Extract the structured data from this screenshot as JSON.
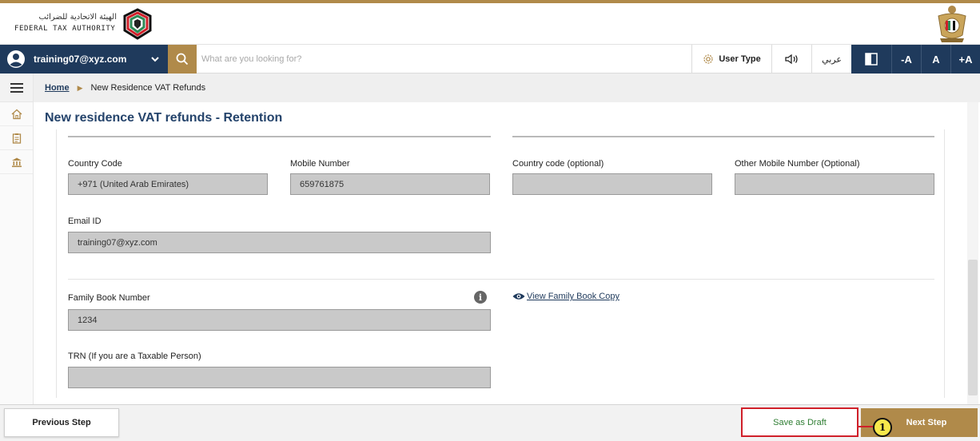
{
  "header": {
    "logo_arabic": "الهيئة الاتحادية للضرائب",
    "logo_english": "FEDERAL TAX AUTHORITY"
  },
  "toolbar": {
    "user_email": "training07@xyz.com",
    "search_placeholder": "What are you looking for?",
    "user_type_label": "User Type",
    "arabic_label": "عربي",
    "font_decrease": "-A",
    "font_normal": "A",
    "font_increase": "+A"
  },
  "breadcrumb": {
    "home": "Home",
    "current": "New Residence VAT Refunds"
  },
  "page": {
    "title": "New residence VAT refunds - Retention"
  },
  "form": {
    "country_code": {
      "label": "Country Code",
      "value": "+971 (United Arab Emirates)"
    },
    "mobile_number": {
      "label": "Mobile Number",
      "value": "659761875"
    },
    "country_code_optional": {
      "label": "Country code (optional)",
      "value": ""
    },
    "other_mobile": {
      "label": "Other Mobile Number (Optional)",
      "value": ""
    },
    "email": {
      "label": "Email ID",
      "value": "training07@xyz.com"
    },
    "family_book": {
      "label": "Family Book Number",
      "value": "1234",
      "view_link": "View Family Book Copy",
      "info": "i"
    },
    "trn": {
      "label": "TRN (If you are a Taxable Person)",
      "value": ""
    }
  },
  "footer": {
    "previous": "Previous Step",
    "save_draft": "Save as Draft",
    "next": "Next Step",
    "callout_number": "1"
  },
  "colors": {
    "navy": "#1f3a5c",
    "gold": "#b08a4a",
    "highlight_red": "#d0202a",
    "draft_green": "#2e7d32"
  }
}
